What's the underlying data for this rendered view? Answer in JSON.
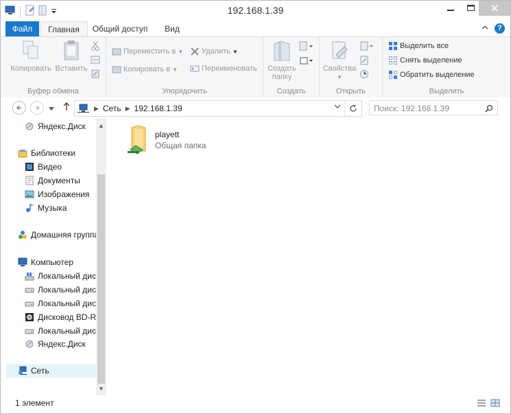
{
  "window": {
    "title": "192.168.1.39"
  },
  "ribbon_tabs": [
    {
      "label": "Файл"
    },
    {
      "label": "Главная"
    },
    {
      "label": "Общий доступ"
    },
    {
      "label": "Вид"
    }
  ],
  "ribbon": {
    "clipboard": {
      "label": "Буфер обмена",
      "copy": "Копировать",
      "paste": "Вставить"
    },
    "organize": {
      "label": "Упорядочить",
      "move_to": "Переместить в",
      "copy_to": "Копировать в",
      "delete": "Удалить",
      "rename": "Переименовать"
    },
    "create": {
      "label": "Создать",
      "new_folder_line1": "Создать",
      "new_folder_line2": "папку"
    },
    "open": {
      "label": "Открыть",
      "properties": "Свойства"
    },
    "select": {
      "label": "Выделить",
      "select_all": "Выделить все",
      "select_none": "Снять выделение",
      "invert": "Обратить выделение"
    }
  },
  "address": {
    "crumbs": [
      "Сеть",
      "192.168.1.39"
    ],
    "search_placeholder": "Поиск: 192.168.1.39"
  },
  "nav": {
    "items": [
      {
        "label": "Яндекс.Диск"
      },
      {
        "label": "Библиотеки"
      },
      {
        "label": "Видео"
      },
      {
        "label": "Документы"
      },
      {
        "label": "Изображения"
      },
      {
        "label": "Музыка"
      },
      {
        "label": "Домашняя группа"
      },
      {
        "label": "Компьютер"
      },
      {
        "label": "Локальный диск"
      },
      {
        "label": "Локальный диск"
      },
      {
        "label": "Локальный диск"
      },
      {
        "label": "Дисковод BD-ROM"
      },
      {
        "label": "Локальный диск"
      },
      {
        "label": "Яндекс.Диск"
      },
      {
        "label": "Сеть"
      }
    ]
  },
  "content": {
    "items": [
      {
        "name": "playett",
        "type": "Общая папка"
      }
    ]
  },
  "status": {
    "count": "1 элемент"
  },
  "colors": {
    "accent": "#1979ca",
    "selection": "#e5f3fb",
    "folder": "#f5c95c"
  }
}
